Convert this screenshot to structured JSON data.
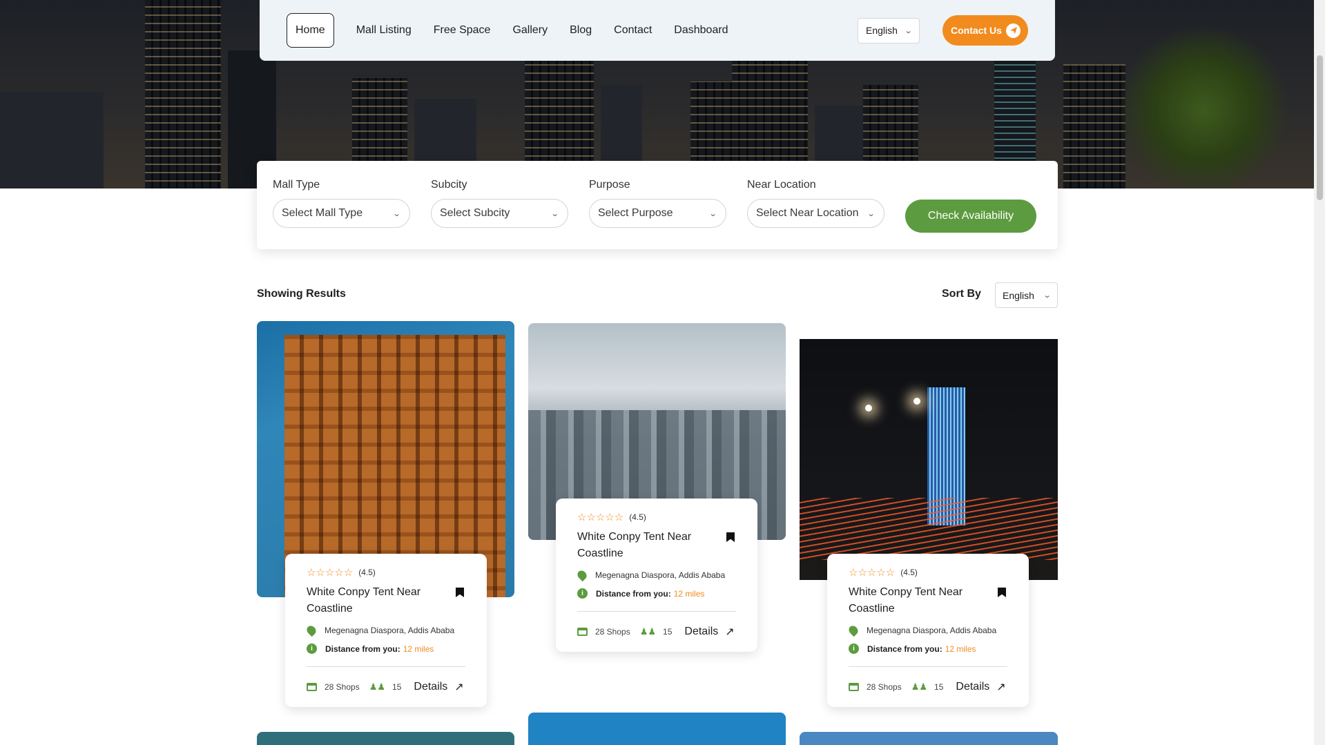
{
  "nav": {
    "items": [
      "Home",
      "Mall Listing",
      "Free Space",
      "Gallery",
      "Blog",
      "Contact",
      "Dashboard"
    ],
    "language": "English",
    "contact_label": "Contact Us"
  },
  "search": {
    "fields": [
      {
        "label": "Mall Type",
        "placeholder": "Select Mall Type"
      },
      {
        "label": "Subcity",
        "placeholder": "Select Subcity"
      },
      {
        "label": "Purpose",
        "placeholder": "Select Purpose"
      },
      {
        "label": "Near Location",
        "placeholder": "Select Near Location"
      }
    ],
    "button_label": "Check Availability"
  },
  "results": {
    "heading": "Showing Results",
    "sort_label": "Sort By",
    "sort_value": "English"
  },
  "listings": [
    {
      "rating": "(4.5)",
      "rating_value": 4.5,
      "title": "White Conpy Tent Near Coastline",
      "location": "Megenagna Diaspora, Addis Ababa",
      "distance_label": "Distance from you:",
      "distance": "12 miles",
      "shops": "28 Shops",
      "people": "15",
      "details_label": "Details"
    },
    {
      "rating": "(4.5)",
      "rating_value": 4.5,
      "title": "White Conpy Tent Near Coastline",
      "location": "Megenagna Diaspora, Addis Ababa",
      "distance_label": "Distance from you:",
      "distance": "12 miles",
      "shops": "28 Shops",
      "people": "15",
      "details_label": "Details"
    },
    {
      "rating": "(4.5)",
      "rating_value": 4.5,
      "title": "White Conpy Tent Near Coastline",
      "location": "Megenagna Diaspora, Addis Ababa",
      "distance_label": "Distance from you:",
      "distance": "12 miles",
      "shops": "28 Shops",
      "people": "15",
      "details_label": "Details"
    }
  ],
  "colors": {
    "accent_orange": "#f28b1e",
    "accent_green": "#5c9b3f",
    "nav_bg": "#eef3f8"
  },
  "icons": [
    "send-icon",
    "chevron-down-icon",
    "star-icon",
    "bookmark-icon",
    "location-pin-icon",
    "info-icon",
    "shop-icon",
    "people-icon",
    "arrow-up-right-icon"
  ]
}
